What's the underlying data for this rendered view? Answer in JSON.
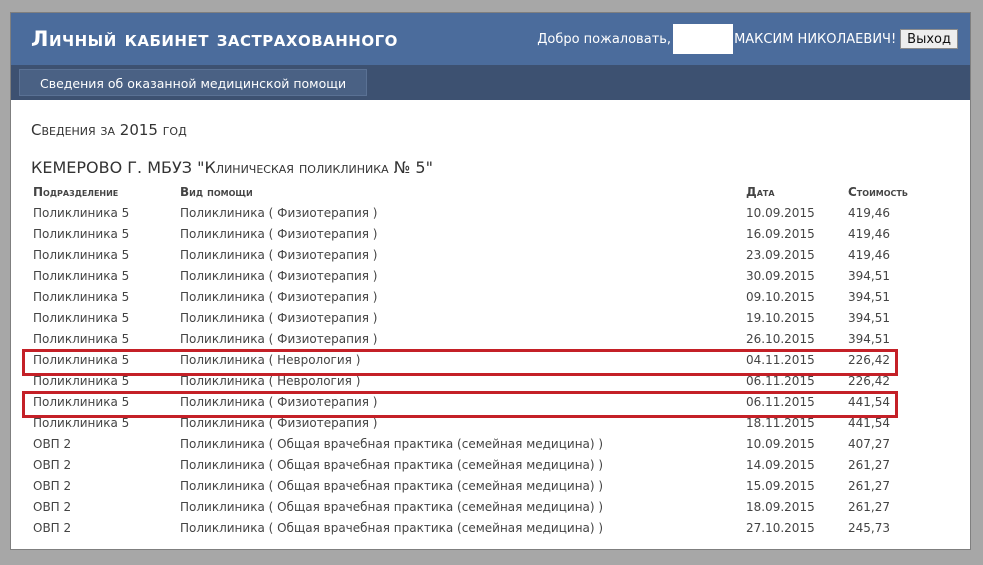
{
  "header": {
    "title": "Личный кабинет застрахованного",
    "welcome": "Добро пожаловать,",
    "user_name": "МАКСИМ НИКОЛАЕВИЧ!",
    "logout_label": "Выход"
  },
  "nav": {
    "items": [
      {
        "label": "Сведения об оказанной медицинской помощи"
      }
    ]
  },
  "main": {
    "section_title": "Сведения за 2015 год",
    "org_title": "КЕМЕРОВО Г. МБУЗ \"Клиническая поликлиника № 5\"",
    "columns": [
      "Подразделение",
      "Вид помощи",
      "Дата",
      "Стоимость"
    ],
    "rows": [
      [
        "Поликлиника 5",
        "Поликлиника ( Физиотерапия )",
        "10.09.2015",
        "419,46"
      ],
      [
        "Поликлиника 5",
        "Поликлиника ( Физиотерапия )",
        "16.09.2015",
        "419,46"
      ],
      [
        "Поликлиника 5",
        "Поликлиника ( Физиотерапия )",
        "23.09.2015",
        "419,46"
      ],
      [
        "Поликлиника 5",
        "Поликлиника ( Физиотерапия )",
        "30.09.2015",
        "394,51"
      ],
      [
        "Поликлиника 5",
        "Поликлиника ( Физиотерапия )",
        "09.10.2015",
        "394,51"
      ],
      [
        "Поликлиника 5",
        "Поликлиника ( Физиотерапия )",
        "19.10.2015",
        "394,51"
      ],
      [
        "Поликлиника 5",
        "Поликлиника ( Физиотерапия )",
        "26.10.2015",
        "394,51"
      ],
      [
        "Поликлиника 5",
        "Поликлиника ( Неврология )",
        "04.11.2015",
        "226,42"
      ],
      [
        "Поликлиника 5",
        "Поликлиника ( Неврология )",
        "06.11.2015",
        "226,42"
      ],
      [
        "Поликлиника 5",
        "Поликлиника ( Физиотерапия )",
        "06.11.2015",
        "441,54"
      ],
      [
        "Поликлиника 5",
        "Поликлиника ( Физиотерапия )",
        "18.11.2015",
        "441,54"
      ],
      [
        "ОВП 2",
        "Поликлиника ( Общая врачебная практика (семейная медицина) )",
        "10.09.2015",
        "407,27"
      ],
      [
        "ОВП 2",
        "Поликлиника ( Общая врачебная практика (семейная медицина) )",
        "14.09.2015",
        "261,27"
      ],
      [
        "ОВП 2",
        "Поликлиника ( Общая врачебная практика (семейная медицина) )",
        "15.09.2015",
        "261,27"
      ],
      [
        "ОВП 2",
        "Поликлиника ( Общая врачебная практика (семейная медицина) )",
        "18.09.2015",
        "261,27"
      ],
      [
        "ОВП 2",
        "Поликлиника ( Общая врачебная практика (семейная медицина) )",
        "27.10.2015",
        "245,73"
      ]
    ]
  },
  "colors": {
    "header_bg": "#4b6c9c",
    "nav_bg": "#3d5171",
    "highlight": "#c42027"
  }
}
